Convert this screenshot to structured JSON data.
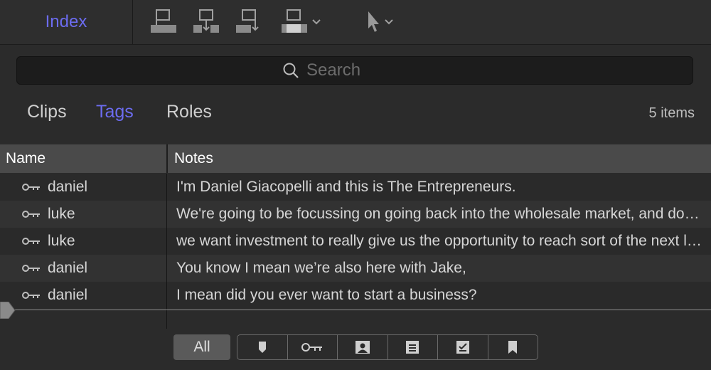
{
  "header": {
    "title": "Index"
  },
  "toolbar": {
    "buttons": [
      "connect-icon",
      "insert-icon",
      "append-icon",
      "overwrite-icon",
      "select-tool-icon"
    ]
  },
  "search": {
    "placeholder": "Search",
    "value": ""
  },
  "tabs": [
    {
      "label": "Clips",
      "active": false
    },
    {
      "label": "Tags",
      "active": true
    },
    {
      "label": "Roles",
      "active": false
    }
  ],
  "item_count": "5 items",
  "table": {
    "columns": [
      "Name",
      "Notes"
    ],
    "rows": [
      {
        "name": "daniel",
        "notes": "I'm Daniel Giacopelli and this is The Entrepreneurs."
      },
      {
        "name": "luke",
        "notes": "We're going to be focussing on going back into the wholesale market, and doing a lot of that business"
      },
      {
        "name": "luke",
        "notes": "we want investment to really give us the opportunity to reach sort of the next level"
      },
      {
        "name": "daniel",
        "notes": "You know I mean we’re also here with Jake,"
      },
      {
        "name": "daniel",
        "notes": "I mean did you ever want to start a business?"
      }
    ]
  },
  "filters": {
    "all_label": "All",
    "icons": [
      "marker-icon",
      "keyword-icon",
      "analysis-keyword-icon",
      "todo-icon",
      "completed-todo-icon",
      "chapter-marker-icon"
    ]
  },
  "colors": {
    "accent": "#6c6cf0",
    "background": "#2b2b2b",
    "header_row": "#4a4a4a"
  }
}
